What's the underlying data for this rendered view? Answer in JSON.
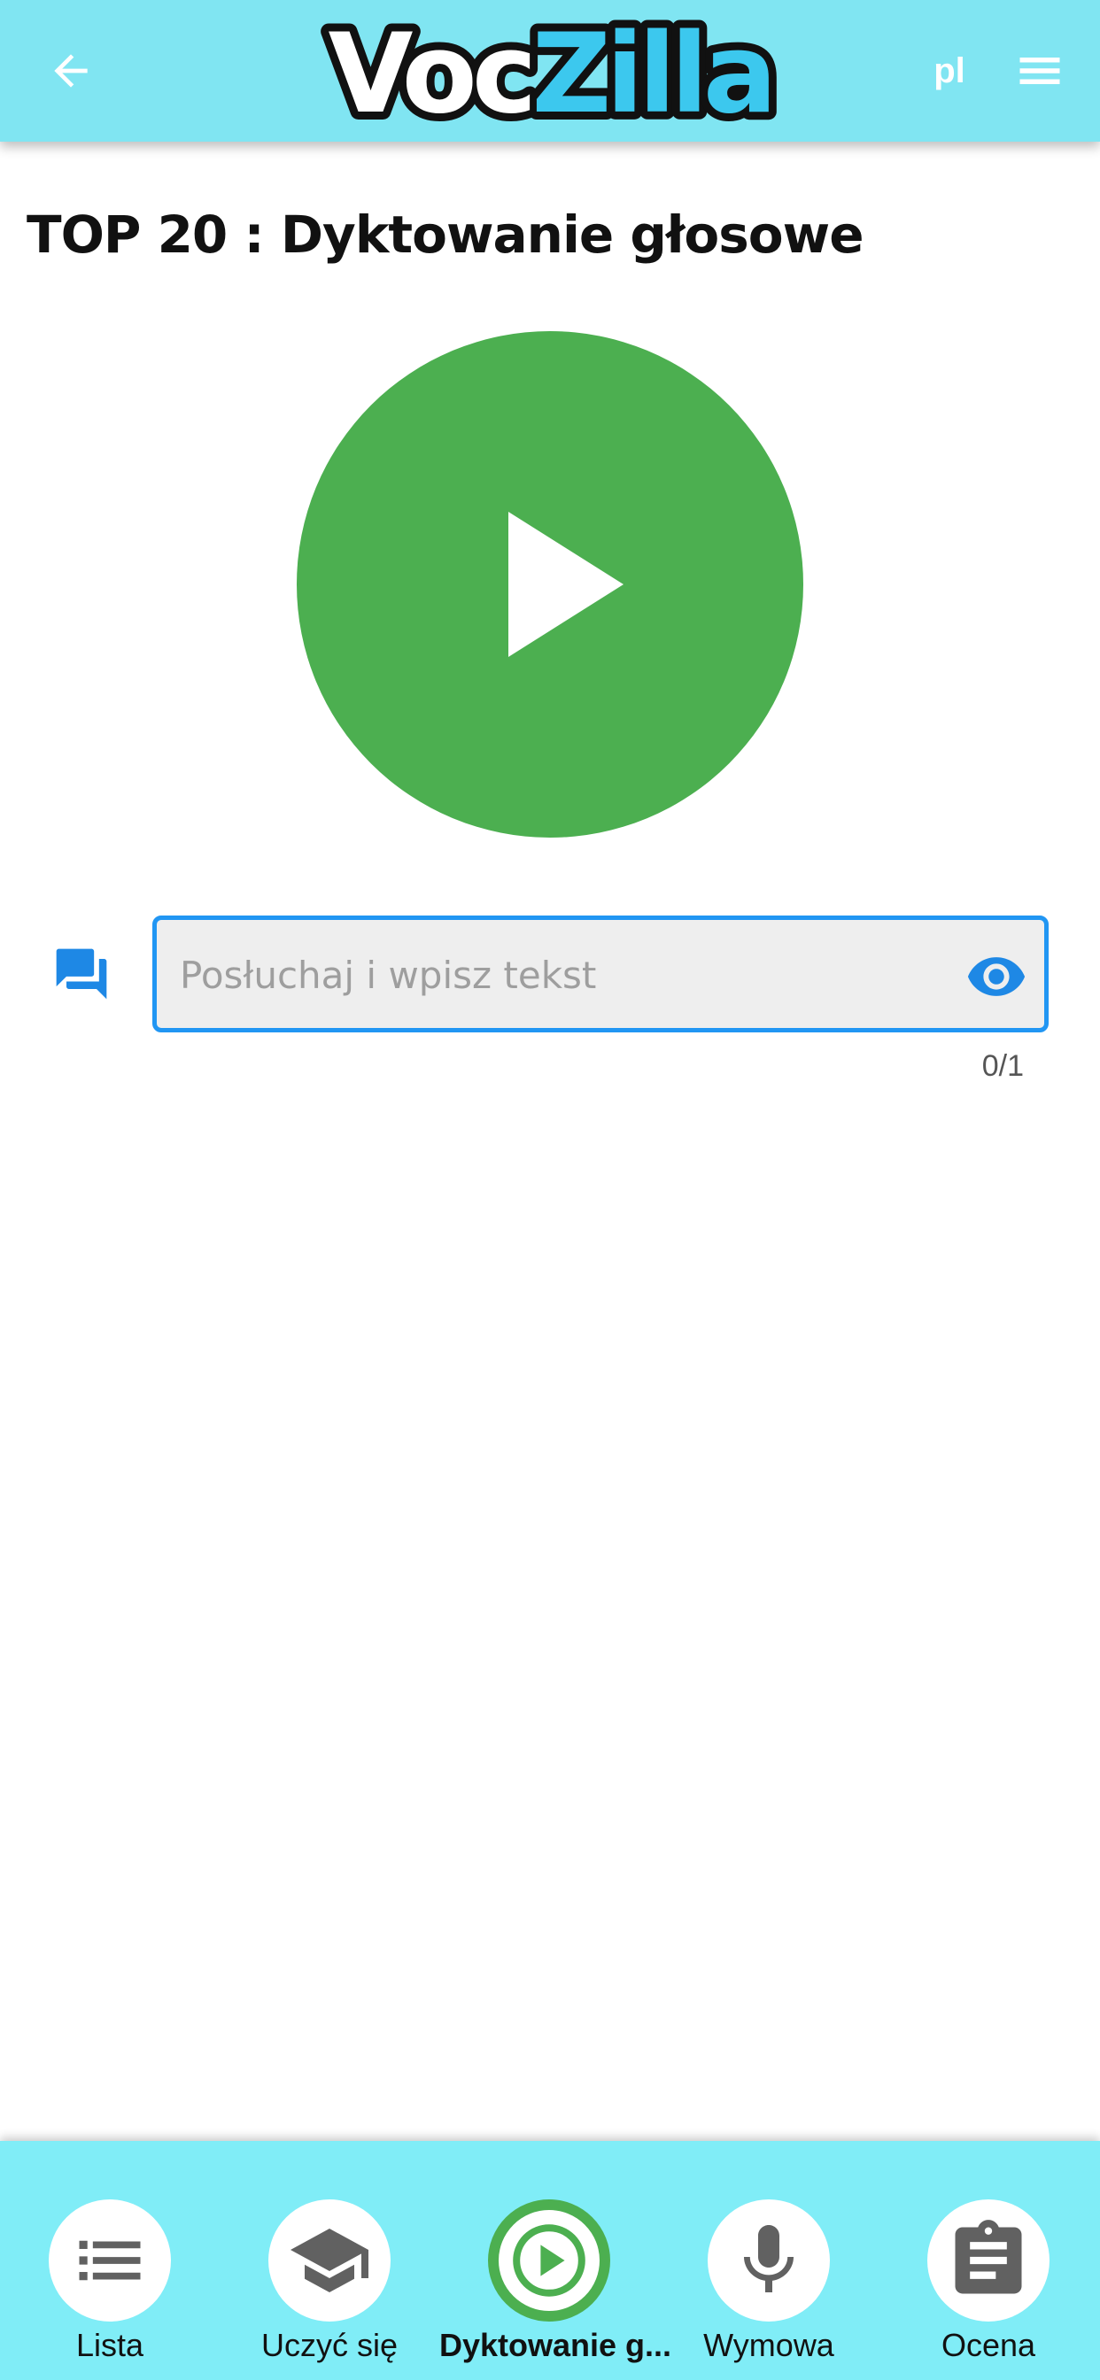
{
  "header": {
    "logo_text_dark": "Voc",
    "logo_text_accent": "Zilla",
    "language": "pl",
    "back_icon": "arrow-left-icon",
    "menu_icon": "hamburger-menu-icon"
  },
  "page": {
    "title": "TOP 20 : Dyktowanie głosowe"
  },
  "player": {
    "icon": "play-icon",
    "color": "#4caf50"
  },
  "dictation": {
    "input_value": "",
    "placeholder": "Posłuchaj i wpisz tekst",
    "counter": "0/1",
    "chat_icon": "chat-bubbles-icon",
    "reveal_icon": "eye-icon",
    "accent_color": "#2196f3"
  },
  "nav": {
    "items": [
      {
        "label": "Lista",
        "icon": "list-icon",
        "active": false
      },
      {
        "label": "Uczyć się",
        "icon": "graduation-cap-icon",
        "active": false
      },
      {
        "label": "Dyktowanie g...",
        "icon": "play-circle-icon",
        "active": true
      },
      {
        "label": "Wymowa",
        "icon": "microphone-icon",
        "active": false
      },
      {
        "label": "Ocena",
        "icon": "clipboard-icon",
        "active": false
      }
    ],
    "background": "#80edf7"
  }
}
